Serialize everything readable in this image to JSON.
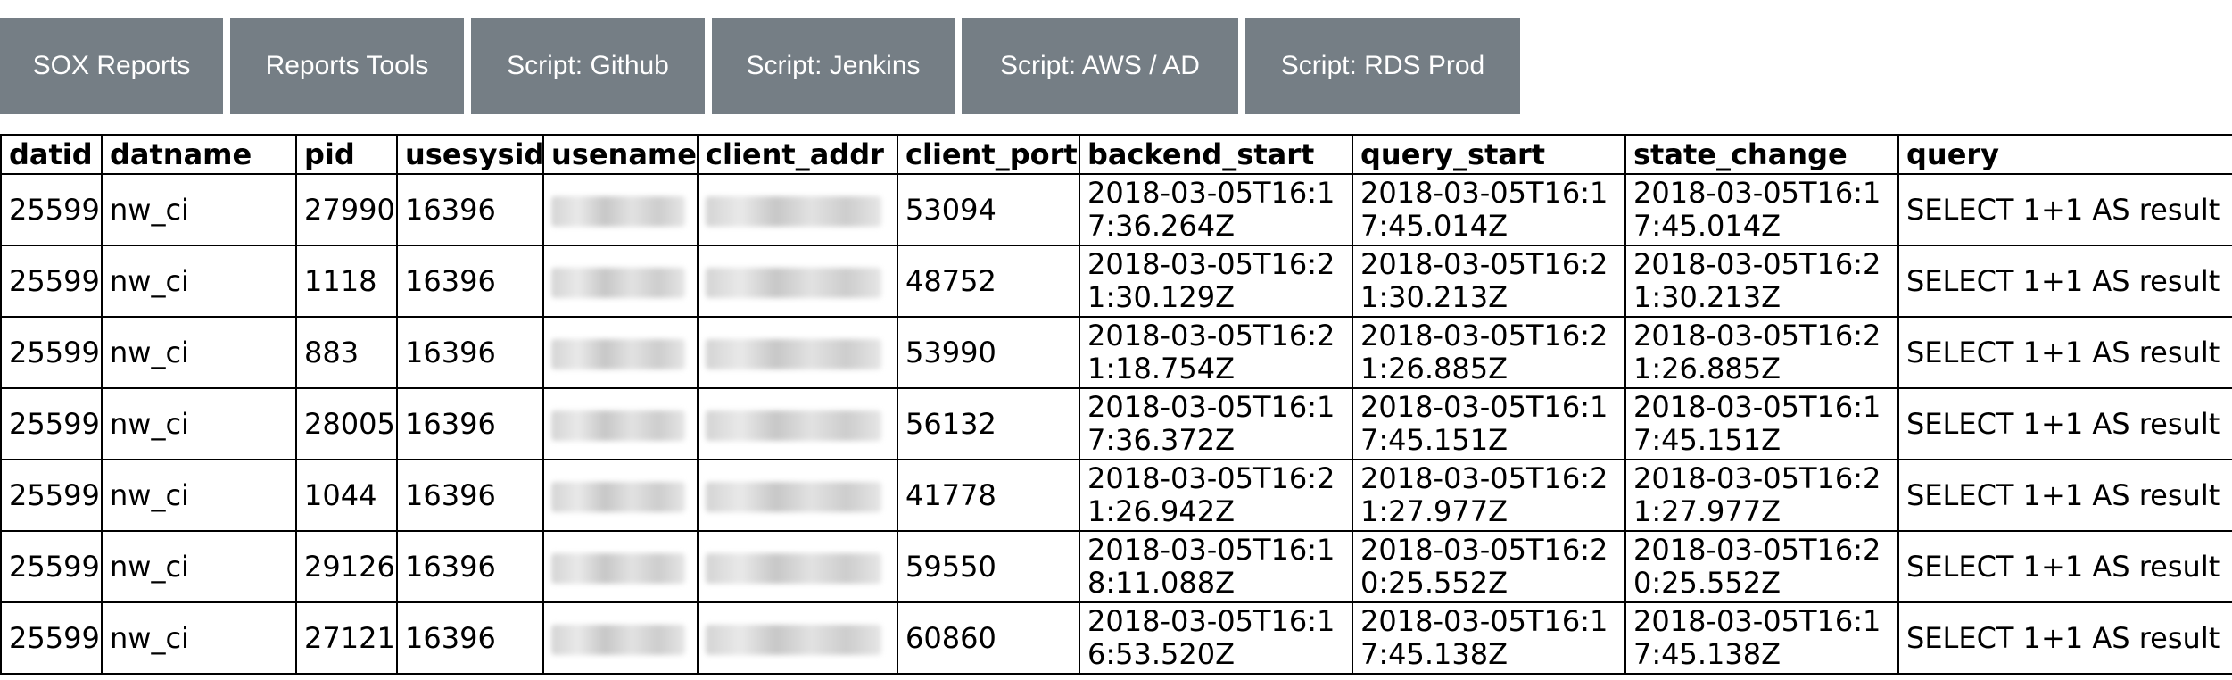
{
  "nav": {
    "buttons": [
      {
        "label": "SOX Reports"
      },
      {
        "label": "Reports Tools"
      },
      {
        "label": "Script: Github"
      },
      {
        "label": "Script: Jenkins"
      },
      {
        "label": "Script: AWS / AD"
      },
      {
        "label": "Script: RDS Prod"
      }
    ],
    "button_color": "#757e85"
  },
  "table": {
    "headers": [
      "datid",
      "datname",
      "pid",
      "usesysid",
      "usename",
      "client_addr",
      "client_port",
      "backend_start",
      "query_start",
      "state_change",
      "query"
    ],
    "rows": [
      {
        "datid": "25599",
        "datname": "nw_ci",
        "pid": "27990",
        "usesysid": "16396",
        "client_port": "53094",
        "backend_start": "2018-03-05T16:17:36.264Z",
        "query_start": "2018-03-05T16:17:45.014Z",
        "state_change": "2018-03-05T16:17:45.014Z",
        "query": "SELECT 1+1 AS result"
      },
      {
        "datid": "25599",
        "datname": "nw_ci",
        "pid": "1118",
        "usesysid": "16396",
        "client_port": "48752",
        "backend_start": "2018-03-05T16:21:30.129Z",
        "query_start": "2018-03-05T16:21:30.213Z",
        "state_change": "2018-03-05T16:21:30.213Z",
        "query": "SELECT 1+1 AS result"
      },
      {
        "datid": "25599",
        "datname": "nw_ci",
        "pid": "883",
        "usesysid": "16396",
        "client_port": "53990",
        "backend_start": "2018-03-05T16:21:18.754Z",
        "query_start": "2018-03-05T16:21:26.885Z",
        "state_change": "2018-03-05T16:21:26.885Z",
        "query": "SELECT 1+1 AS result"
      },
      {
        "datid": "25599",
        "datname": "nw_ci",
        "pid": "28005",
        "usesysid": "16396",
        "client_port": "56132",
        "backend_start": "2018-03-05T16:17:36.372Z",
        "query_start": "2018-03-05T16:17:45.151Z",
        "state_change": "2018-03-05T16:17:45.151Z",
        "query": "SELECT 1+1 AS result"
      },
      {
        "datid": "25599",
        "datname": "nw_ci",
        "pid": "1044",
        "usesysid": "16396",
        "client_port": "41778",
        "backend_start": "2018-03-05T16:21:26.942Z",
        "query_start": "2018-03-05T16:21:27.977Z",
        "state_change": "2018-03-05T16:21:27.977Z",
        "query": "SELECT 1+1 AS result"
      },
      {
        "datid": "25599",
        "datname": "nw_ci",
        "pid": "29126",
        "usesysid": "16396",
        "client_port": "59550",
        "backend_start": "2018-03-05T16:18:11.088Z",
        "query_start": "2018-03-05T16:20:25.552Z",
        "state_change": "2018-03-05T16:20:25.552Z",
        "query": "SELECT 1+1 AS result"
      },
      {
        "datid": "25599",
        "datname": "nw_ci",
        "pid": "27121",
        "usesysid": "16396",
        "client_port": "60860",
        "backend_start": "2018-03-05T16:16:53.520Z",
        "query_start": "2018-03-05T16:17:45.138Z",
        "state_change": "2018-03-05T16:17:45.138Z",
        "query": "SELECT 1+1 AS result"
      }
    ]
  }
}
